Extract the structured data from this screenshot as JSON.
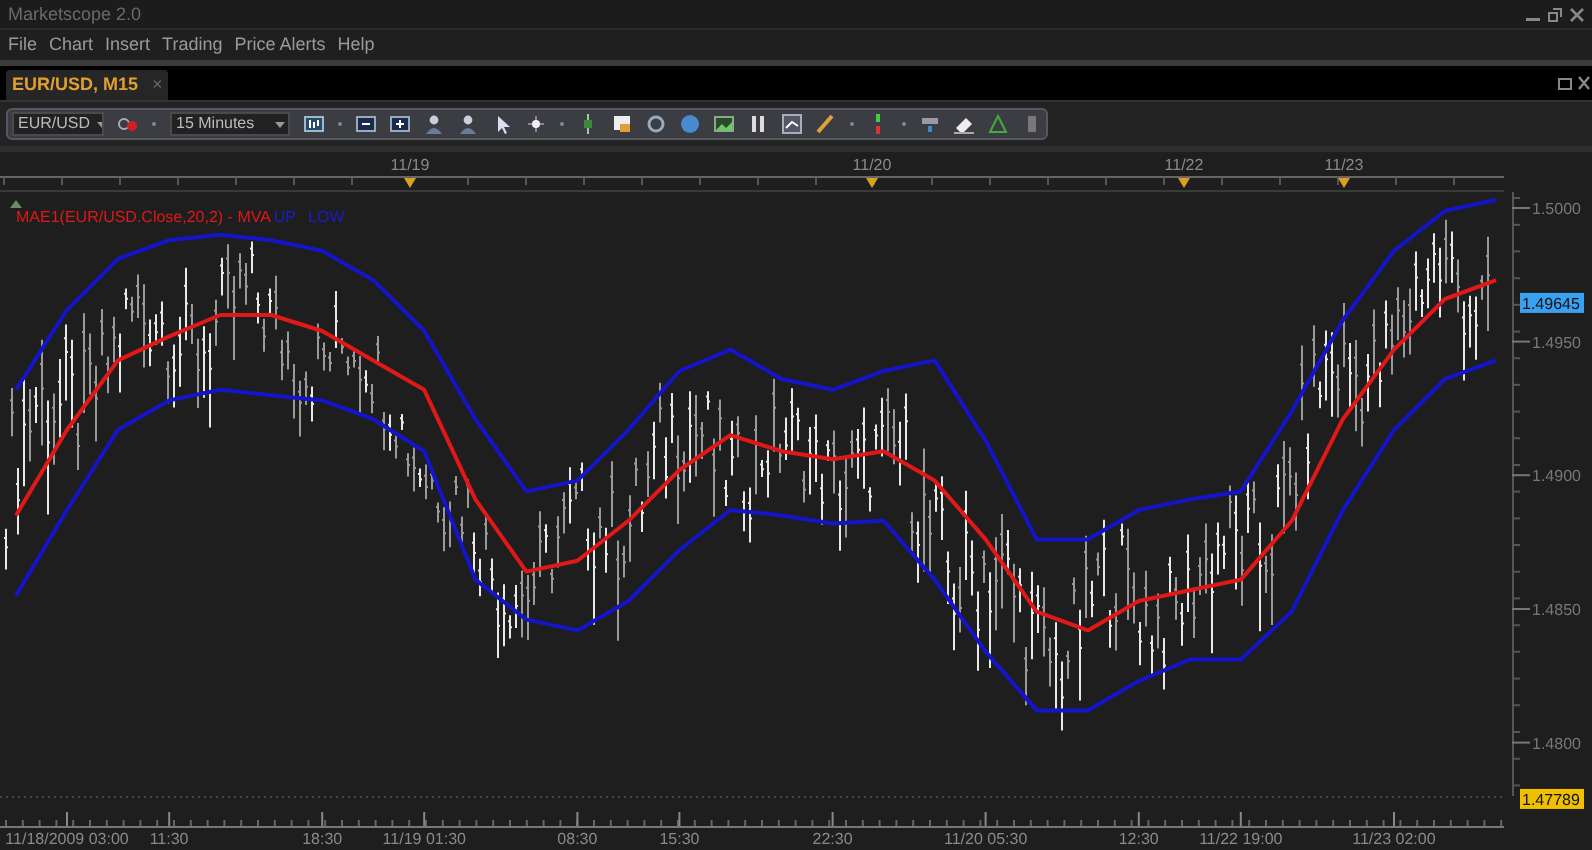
{
  "window": {
    "title": "Marketscope 2.0"
  },
  "menu": [
    "File",
    "Chart",
    "Insert",
    "Trading",
    "Price Alerts",
    "Help"
  ],
  "tabs": [
    {
      "label": "EUR/USD, M15",
      "selected": true,
      "close": "×"
    }
  ],
  "toolbar": {
    "instrument": "EUR/USD",
    "timeframe": "15 Minutes"
  },
  "chart": {
    "legend": [
      {
        "text": "UP",
        "color": "#1c1cc8"
      },
      {
        "text": "LOW",
        "color": "#1c1cc8"
      }
    ],
    "date_markers": [
      "11/19",
      "11/20",
      "11/22",
      "11/23"
    ],
    "price_tags": [
      {
        "text": "1.49645",
        "color": "#3aa0f0"
      },
      {
        "text": "1.47789",
        "color": "#f0c000"
      }
    ],
    "chart_data": {
      "type": "line",
      "categories": [
        null,
        "11/18/2009 03:00",
        null,
        "11:30",
        null,
        null,
        "18:30",
        null,
        "11/19 01:30",
        null,
        null,
        "08:30",
        null,
        "15:30",
        null,
        null,
        "22:30",
        null,
        null,
        "11/20 05:30",
        null,
        null,
        "12:30",
        null,
        "11/22 19:00",
        null,
        null,
        "11/23 02:00",
        null,
        null
      ],
      "series": [
        {
          "name": "MAE1(EUR/USD.Close,20,2) - MVA",
          "color": "#e01818",
          "values": [
            1.4885,
            1.4917,
            1.4943,
            1.4952,
            1.496,
            1.496,
            1.4954,
            1.4943,
            1.4932,
            1.4891,
            1.4864,
            1.4868,
            1.4883,
            1.4902,
            1.4915,
            1.4909,
            1.4906,
            1.4909,
            1.4898,
            1.4876,
            1.4849,
            1.4842,
            1.4853,
            1.4857,
            1.4861,
            1.4883,
            1.4921,
            1.4947,
            1.4966,
            1.4973
          ]
        },
        {
          "color": "#1414c8",
          "values": [
            1.4932,
            1.4962,
            1.4981,
            1.4988,
            1.499,
            1.4988,
            1.4984,
            1.4973,
            1.4954,
            1.4921,
            1.4894,
            1.4898,
            1.4917,
            1.4939,
            1.4947,
            1.4936,
            1.4932,
            1.4939,
            1.4943,
            1.4913,
            1.4876,
            1.4876,
            1.4887,
            1.4891,
            1.4894,
            1.4924,
            1.4958,
            1.4984,
            1.4999,
            1.5003
          ]
        },
        {
          "color": "#1414c8",
          "values": [
            1.4855,
            1.4887,
            1.4917,
            1.4928,
            1.4932,
            1.493,
            1.4928,
            1.4921,
            1.4909,
            1.4861,
            1.4846,
            1.4842,
            1.4853,
            1.4872,
            1.4887,
            1.4885,
            1.4882,
            1.4883,
            1.4861,
            1.4834,
            1.4812,
            1.4812,
            1.4823,
            1.4831,
            1.4831,
            1.4849,
            1.4887,
            1.4917,
            1.4936,
            1.4943
          ]
        }
      ],
      "ylim": [
        1.478,
        1.5006
      ],
      "yticks": [
        {
          "value": 1.48,
          "label": "1.4800"
        },
        {
          "value": 1.485,
          "label": "1.4850"
        },
        {
          "value": 1.49,
          "label": "1.4900"
        },
        {
          "value": 1.495,
          "label": "1.4950"
        },
        {
          "value": 1.5,
          "label": "1.5000"
        }
      ]
    }
  }
}
